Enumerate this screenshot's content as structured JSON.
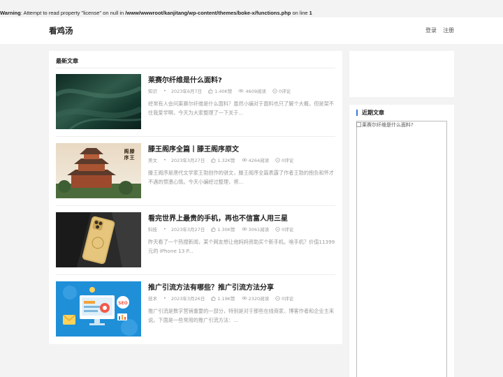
{
  "warning": {
    "label": "Warning",
    "message": ": Attempt to read property \"license\" on null in ",
    "path": "/www/wwwroot/kanjitang/wp-content/themes/boke-x/functions.php",
    "line_text": " on line ",
    "line_no": "1"
  },
  "header": {
    "site_title": "看鸡汤",
    "login": "登录",
    "register": "注册"
  },
  "main": {
    "section_title": "最新文章",
    "posts": [
      {
        "title": "莱赛尔纤维是什么面料?",
        "category": "知识",
        "date": "2023年6月7日",
        "likes": "1.40K赞",
        "views": "4609阅读",
        "comments": "0评论",
        "excerpt": "经常有人会问莱赛尔纤维是什么面料？虽然小编对于面料也只了解个大概，但是架不住我爱学啊，今天为大家整理了一下关于..."
      },
      {
        "title": "滕王阁序全篇丨滕王阁序原文",
        "category": "美文",
        "date": "2023年3月27日",
        "likes": "1.32K赞",
        "views": "4264阅读",
        "comments": "0评论",
        "excerpt": "滕王阁序是唐代文学家王勃创作的骈文，滕王阁序全篇表露了作者王勃的抱负和怀才不遇的愤懑心情。今天小编经过整理，将...",
        "image_text": "滕王阁序"
      },
      {
        "title": "看完世界上最贵的手机，再也不信富人用三星",
        "category": "科技",
        "date": "2023年3月27日",
        "likes": "1.30K赞",
        "views": "3061阅读",
        "comments": "0评论",
        "excerpt": "昨天看了一个热搜新闻，某个网友想让他妈妈资助买个新手机。啥手机？价值11399 元的 iPhone 13 P..."
      },
      {
        "title": "推广引流方法有哪些？推广引流方法分享",
        "category": "技术",
        "date": "2023年3月26日",
        "likes": "1.19K赞",
        "views": "2320阅读",
        "comments": "0评论",
        "excerpt": "推广引流是数字营销重要的一部分，特别是对于那些在线商家、博客作者和企业主来说。下面是一些常用的推广引流方法：...",
        "image_text": "SEO"
      }
    ]
  },
  "sidebar": {
    "recent_title": "近期文章",
    "recent_image_alt": "莱赛尔纤维是什么面料?"
  },
  "colors": {
    "accent": "#3a7bd5",
    "background": "#f3f3f3",
    "card": "#ffffff"
  }
}
